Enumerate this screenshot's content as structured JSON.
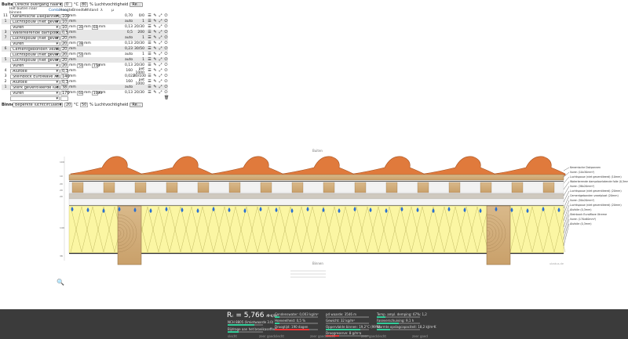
{
  "top": {
    "outside_label": "Buiten",
    "outside_select": "Directe overgang naar buitenlucht",
    "outside_temp": "0",
    "outside_temp_unit": "°C",
    "outside_rh": "80",
    "outside_rh_unit": "% Luchtvochtigheid",
    "outside_button": "Re..."
  },
  "columns": {
    "layer": "Het buiten naar binnen",
    "combine": "Combineer",
    "thickness": "Hoogte",
    "width": "Breedte",
    "distance": "Afstand",
    "u": "λ",
    "r": "μ"
  },
  "layers": [
    {
      "idx": "11",
      "material": "Keramische Dakpannen",
      "thickness": "100",
      "unit": "mm",
      "u": "0,70",
      "r": "0/0",
      "shaded": false
    },
    {
      "idx": "1",
      "material": "Luchtspouw (niet geventileerd)",
      "thickness": "10",
      "unit": "mm",
      "u": "auto",
      "r": "1",
      "shaded": true
    },
    {
      "idx": "",
      "material": "Vuren",
      "thickness": "10",
      "unit": "mm",
      "extra": [
        "30",
        "",
        "60"
      ],
      "u": "0,13",
      "r": "20/30",
      "shaded": false
    },
    {
      "idx": "3",
      "material": "Waterkerende dampdoorlatende folie",
      "thickness": "0,5",
      "unit": "mm",
      "u": "0,5",
      "r": "200",
      "shaded": true
    },
    {
      "idx": "7",
      "material": "Luchtspouw (niet geventileerd)",
      "thickness": "20",
      "unit": "mm",
      "u": "auto",
      "r": "1",
      "shaded": true
    },
    {
      "idx": "",
      "material": "Vuren",
      "thickness": "20",
      "unit": "mm",
      "extra": [
        "38",
        "",
        ""
      ],
      "u": "0,13",
      "r": "20/30",
      "shaded": false
    },
    {
      "idx": "6",
      "material": "Cementgebonden vezelplaat",
      "thickness": "20",
      "unit": "mm",
      "u": "0,23",
      "r": "30/50",
      "shaded": true
    },
    {
      "idx": "",
      "material": "Luchtspouw (niet geventileerd)",
      "thickness": "20",
      "unit": "mm",
      "extra": [
        "50",
        "",
        ""
      ],
      "u": "auto",
      "r": "1",
      "shaded": false
    },
    {
      "idx": "5",
      "material": "Luchtspouw (niet geventileerd)",
      "thickness": "20",
      "unit": "mm",
      "u": "auto",
      "r": "1",
      "shaded": true
    },
    {
      "idx": "",
      "material": "Vuren",
      "thickness": "20",
      "unit": "mm",
      "extra": [
        "50",
        "",
        "150"
      ],
      "u": "0,13",
      "r": "20/30",
      "shaded": false
    },
    {
      "idx": "4",
      "material": "Alufolie",
      "thickness": "0,3",
      "unit": "mm",
      "u": "160",
      "r": "pet 1000",
      "shaded": false
    },
    {
      "idx": "3",
      "material": "Steinbock EuroWave Xtreme",
      "thickness": "140",
      "unit": "mm",
      "u": "0,022",
      "r": "80/100",
      "shaded": false
    },
    {
      "idx": "2",
      "material": "Alufolie",
      "thickness": "0,3",
      "unit": "mm",
      "u": "160",
      "r": "pet 1000",
      "shaded": false
    },
    {
      "idx": "1",
      "material": "Sterk geventileerde luchtlaag (binnen)",
      "thickness": "38",
      "unit": "mm",
      "u": "auto",
      "r": "",
      "shaded": true
    },
    {
      "idx": "",
      "material": "Vuren",
      "thickness": "170",
      "unit": "mm",
      "extra": [
        "60",
        "",
        "1000"
      ],
      "u": "0,13",
      "r": "20/30",
      "shaded": false
    },
    {
      "idx": "",
      "material": "",
      "thickness": "",
      "unit": "",
      "u": "",
      "r": "",
      "shaded": false
    }
  ],
  "bottom": {
    "inside_label": "Binnen",
    "inside_select": "Beperkte luchtcirculatie",
    "inside_temp": "20",
    "inside_temp_unit": "°C",
    "inside_rh": "50",
    "inside_rh_unit": "% Luchtvochtigheid",
    "inside_button": "Re..."
  },
  "drawing": {
    "outside": "Buiten",
    "inside": "Binnen",
    "left_dims": [
      "100",
      "10",
      "20",
      "20",
      "20",
      "140",
      "38"
    ],
    "bottom_dims": [
      "60",
      "1000",
      "80",
      "40",
      "1000"
    ],
    "watermark": "ubakus.de",
    "legend": [
      "Keramische Dakpannen",
      "Vuren (10x30mm²)",
      "Luchtspouw (niet geventileerd) (10mm)",
      "Waterkerende dampdoorlatende folie (0,5mm)",
      "Vuren (38x20mm²)",
      "Luchtspouw (niet geventileerd) (20mm)",
      "Cementgebonden vezelplaat (20mm)",
      "Vuren (50x20mm²)",
      "Luchtspouw (niet geventileerd) (20mm)",
      "Alufolie (0,3mm)",
      "Steinbock EuroWave Xtreme",
      "Vuren (170x60mm²)",
      "Alufolie (0,3mm)"
    ]
  },
  "footer": {
    "r_label": "R",
    "r_value": "5,766",
    "r_unit": "m²K/W",
    "r_sub": "NCH 8805 (limietwaarde 3.0)",
    "r_help": "Bijdrage aan het broeikaseffect",
    "stats": [
      {
        "label": "Condenswater: 0,003 kg/m²",
        "fill": 0.1,
        "color": "#3c9"
      },
      {
        "label": "Hoeveelheid: 0,5 %",
        "fill": 0.1,
        "color": "#3c9"
      },
      {
        "label": "Droogtijd: 190 dagen",
        "fill": 0.8,
        "color": "#e33"
      },
      {
        "label": "pd waarde: 3546 m",
        "fill": 0,
        "color": "#3c9"
      },
      {
        "label": "Gewicht: 32 kg/m²",
        "fill": 0,
        "color": "#3c9"
      },
      {
        "label": "Oppervlakte binnen: 19,2°C (99%)",
        "fill": 0.8,
        "color": "#3c9"
      },
      {
        "label": "Droogreserve: 8 g/m²a",
        "fill": 0.3,
        "color": "#e33"
      },
      {
        "label": "Temp. ampl. demping: 67%: 1,2",
        "fill": 0.2,
        "color": "#3c9"
      },
      {
        "label": "Faseverschuiving: 9,1 h",
        "fill": 0.5,
        "color": "#3c9"
      },
      {
        "label": "Warmte opslagcapaciteit: 18,2 kJ/m²K",
        "fill": 0.3,
        "color": "#3c9"
      }
    ],
    "scale_low": "slecht",
    "scale_high": "zeer goed"
  }
}
